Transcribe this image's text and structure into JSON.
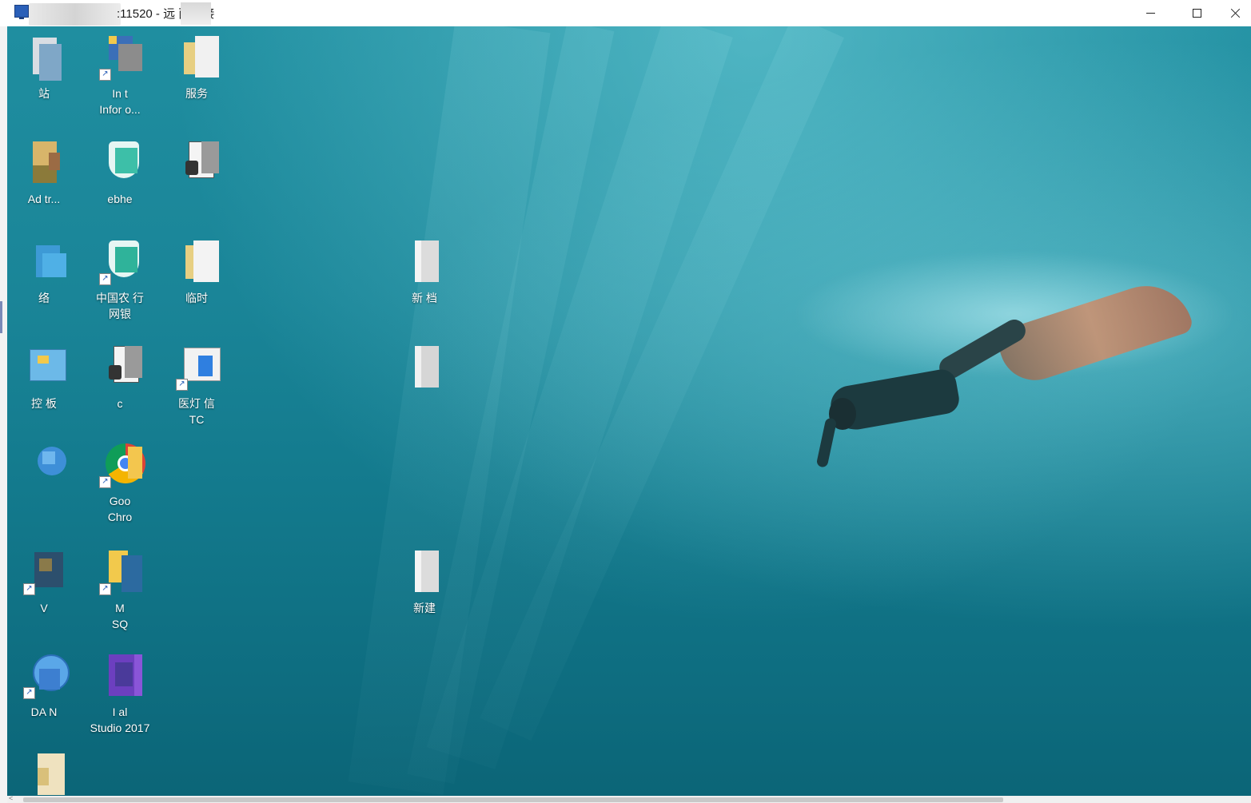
{
  "window": {
    "title_suffix": ":11520 - 远    面连接",
    "buttons": {
      "minimize": "minimize",
      "maximize": "maximize",
      "close": "close"
    }
  },
  "desktop": {
    "icons": [
      {
        "label": "站",
        "icon": "recycle-bin-icon",
        "shortcut": false
      },
      {
        "label": "In       t\nInfor      o...",
        "icon": "iis-manager-icon",
        "shortcut": true
      },
      {
        "label": "服务",
        "icon": "folder-icon",
        "shortcut": false
      },
      {
        "label": "Ad         tr...",
        "icon": "user-folder-icon",
        "shortcut": false
      },
      {
        "label": "ebhe",
        "icon": "shield-app-icon",
        "shortcut": false
      },
      {
        "label": "",
        "icon": "database-doc-icon",
        "shortcut": false
      },
      {
        "label": "络",
        "icon": "network-icon",
        "shortcut": false
      },
      {
        "label": "中国农     行\n网银",
        "icon": "bank-shield-icon",
        "shortcut": true
      },
      {
        "label": "临时",
        "icon": "folder-icon",
        "shortcut": false
      },
      {
        "label": "新                档",
        "icon": "document-icon",
        "shortcut": false
      },
      {
        "label": "控      板",
        "icon": "control-panel-icon",
        "shortcut": false
      },
      {
        "label": "c",
        "icon": "database-doc-icon",
        "shortcut": false
      },
      {
        "label": "医灯         信\nTC",
        "icon": "app-window-icon",
        "shortcut": true
      },
      {
        "label": "",
        "icon": "document-icon",
        "shortcut": false
      },
      {
        "label": "",
        "icon": "globe-network-icon",
        "shortcut": false
      },
      {
        "label": "Goo\nChro",
        "icon": "chrome-icon",
        "shortcut": true
      },
      {
        "label": "V",
        "icon": "app-icon",
        "shortcut": true
      },
      {
        "label": "M\nSQ",
        "icon": "sql-server-icon",
        "shortcut": true
      },
      {
        "label": "新建",
        "icon": "document-icon",
        "shortcut": false
      },
      {
        "label": "DA        N",
        "icon": "globe-app-icon",
        "shortcut": true
      },
      {
        "label": "I         al\nStudio 2017",
        "icon": "visual-studio-icon",
        "shortcut": false
      },
      {
        "label": "",
        "icon": "user-folder-icon",
        "shortcut": false
      }
    ]
  }
}
